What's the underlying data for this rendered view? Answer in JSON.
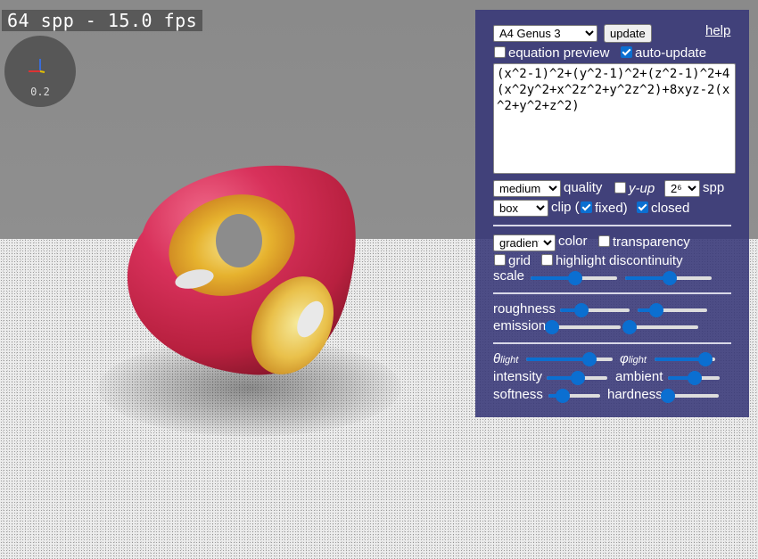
{
  "overlay": {
    "fps_text": "64 spp - 15.0 fps",
    "axes_scale": "0.2"
  },
  "panel": {
    "preset_select": {
      "selected": "A4 Genus 3"
    },
    "update_label": "update",
    "help_label": "help",
    "equation_preview": {
      "label": "equation preview",
      "checked": false
    },
    "auto_update": {
      "label": "auto-update",
      "checked": true
    },
    "equation": "(x^2-1)^2+(y^2-1)^2+(z^2-1)^2+4(x^2y^2+x^2z^2+y^2z^2)+8xyz-2(x^2+y^2+z^2)",
    "quality_select": {
      "selected": "medium"
    },
    "quality_label": "quality",
    "yup": {
      "label": "y-up",
      "checked": false
    },
    "spp_select": {
      "selected": "2⁶"
    },
    "spp_label": "spp",
    "clip_select": {
      "selected": "box"
    },
    "clip_label": "clip (",
    "fixed": {
      "label": "fixed)",
      "checked": true
    },
    "closed": {
      "label": "closed",
      "checked": true
    },
    "color_select": {
      "selected": "gradient"
    },
    "color_label": "color",
    "transparency": {
      "label": "transparency",
      "checked": false
    },
    "grid": {
      "label": "grid",
      "checked": false
    },
    "highlight": {
      "label": "highlight discontinuity",
      "checked": false
    },
    "scale_label": "scale",
    "scale_slider_1": 0.5,
    "scale_slider_2": 0.5,
    "roughness_label": "roughness",
    "roughness_slider_1": 0.3,
    "roughness_slider_2": 0.25,
    "emission_label": "emission",
    "emission_slider_1": 0.0,
    "emission_slider_2": 0.0,
    "theta_label": "θ",
    "theta_sub": "light",
    "phi_label": "φ",
    "phi_sub": "light",
    "theta_slider": 0.72,
    "phi_slider": 0.82,
    "intensity_label": "intensity",
    "intensity_slider": 0.5,
    "ambient_label": "ambient",
    "ambient_slider": 0.5,
    "softness_label": "softness",
    "softness_slider": 0.25,
    "hardness_label": "hardness",
    "hardness_slider": 0.0
  },
  "colors": {
    "panel_bg": "#37377a",
    "accent": "#0b6fd1",
    "surface_outer": "#d8315b",
    "surface_inner": "#e6b22e"
  }
}
